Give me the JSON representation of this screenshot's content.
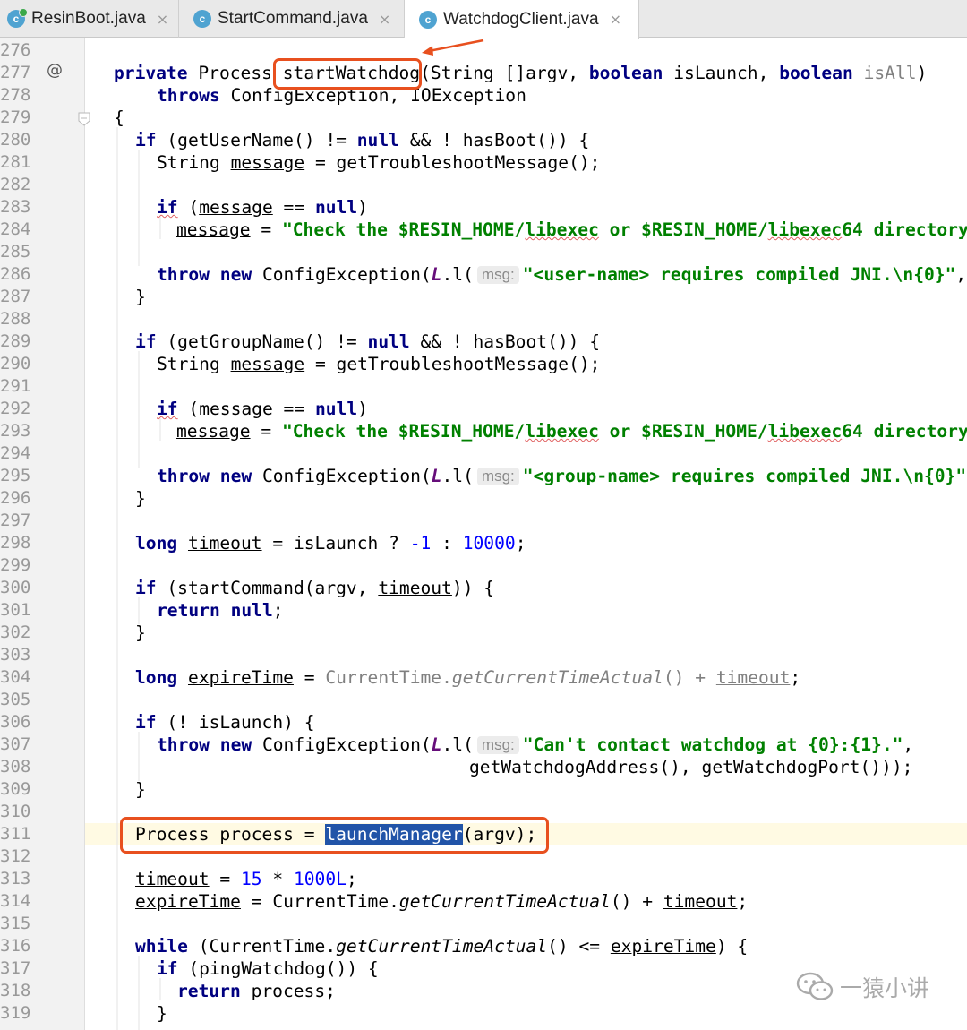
{
  "tabs": [
    {
      "label": "ResinBoot.java",
      "icon": "c",
      "running": true,
      "active": false
    },
    {
      "label": "StartCommand.java",
      "icon": "c",
      "running": false,
      "active": false
    },
    {
      "label": "WatchdogClient.java",
      "icon": "c",
      "running": false,
      "active": true
    }
  ],
  "close_glyph": "×",
  "gutter": {
    "annotation_marker": "@"
  },
  "hint_label": "msg:",
  "watermark": "一猿小讲",
  "annotation_color": "#e8501f",
  "lines": [
    {
      "n": "276",
      "t": []
    },
    {
      "n": "277",
      "t": [
        [
          "private",
          "k"
        ],
        [
          " Process "
        ],
        [
          "startWatchdog"
        ],
        [
          "(String []argv, "
        ],
        [
          "boolean",
          "k"
        ],
        [
          " isLaunch, "
        ],
        [
          "boolean",
          "k"
        ],
        [
          " "
        ],
        [
          "isAll",
          "g"
        ],
        [
          ")"
        ]
      ]
    },
    {
      "n": "278",
      "t": [
        [
          "throws",
          "k"
        ],
        [
          " ConfigException, IOException"
        ]
      ]
    },
    {
      "n": "279",
      "t": [
        [
          "{"
        ]
      ]
    },
    {
      "n": "280",
      "t": [
        [
          "if",
          "k"
        ],
        [
          " (getUserName() != "
        ],
        [
          "null",
          "k"
        ],
        [
          " && ! hasBoot()) {"
        ]
      ]
    },
    {
      "n": "281",
      "t": [
        [
          "String "
        ],
        [
          "message",
          "u"
        ],
        [
          " = getTroubleshootMessage();"
        ]
      ]
    },
    {
      "n": "282",
      "t": []
    },
    {
      "n": "283",
      "t": [
        [
          "if",
          "k w"
        ],
        [
          " ("
        ],
        [
          "message",
          "u"
        ],
        [
          " == "
        ],
        [
          "null",
          "k"
        ],
        [
          ")"
        ]
      ]
    },
    {
      "n": "284",
      "t": [
        [
          "message",
          "u"
        ],
        [
          " = "
        ],
        [
          "\"Check the $RESIN_HOME/",
          "s"
        ],
        [
          "libexec",
          "s w"
        ],
        [
          " or $RESIN_HOME/",
          "s"
        ],
        [
          "libexec",
          "s w"
        ],
        [
          "64 directory",
          "s"
        ]
      ]
    },
    {
      "n": "285",
      "t": []
    },
    {
      "n": "286",
      "t": [
        [
          "throw",
          "k"
        ],
        [
          " "
        ],
        [
          "new",
          "k"
        ],
        [
          " ConfigException("
        ],
        [
          "L",
          "f"
        ],
        [
          ".l("
        ],
        [
          "msg:",
          "hint"
        ],
        [
          "\"<user-name> requires compiled JNI.\\n{0}\"",
          "s"
        ],
        [
          ","
        ]
      ]
    },
    {
      "n": "287",
      "t": [
        [
          "}"
        ]
      ]
    },
    {
      "n": "288",
      "t": []
    },
    {
      "n": "289",
      "t": [
        [
          "if",
          "k"
        ],
        [
          " (getGroupName() != "
        ],
        [
          "null",
          "k"
        ],
        [
          " && ! hasBoot()) {"
        ]
      ]
    },
    {
      "n": "290",
      "t": [
        [
          "String "
        ],
        [
          "message",
          "u"
        ],
        [
          " = getTroubleshootMessage();"
        ]
      ]
    },
    {
      "n": "291",
      "t": []
    },
    {
      "n": "292",
      "t": [
        [
          "if",
          "k w"
        ],
        [
          " ("
        ],
        [
          "message",
          "u"
        ],
        [
          " == "
        ],
        [
          "null",
          "k"
        ],
        [
          ")"
        ]
      ]
    },
    {
      "n": "293",
      "t": [
        [
          "message",
          "u"
        ],
        [
          " = "
        ],
        [
          "\"Check the $RESIN_HOME/",
          "s"
        ],
        [
          "libexec",
          "s w"
        ],
        [
          " or $RESIN_HOME/",
          "s"
        ],
        [
          "libexec",
          "s w"
        ],
        [
          "64 directory",
          "s"
        ]
      ]
    },
    {
      "n": "294",
      "t": []
    },
    {
      "n": "295",
      "t": [
        [
          "throw",
          "k"
        ],
        [
          " "
        ],
        [
          "new",
          "k"
        ],
        [
          " ConfigException("
        ],
        [
          "L",
          "f"
        ],
        [
          ".l("
        ],
        [
          "msg:",
          "hint"
        ],
        [
          "\"<group-name> requires compiled JNI.\\n{0}\"",
          "s"
        ]
      ]
    },
    {
      "n": "296",
      "t": [
        [
          "}"
        ]
      ]
    },
    {
      "n": "297",
      "t": []
    },
    {
      "n": "298",
      "t": [
        [
          "long",
          "k"
        ],
        [
          " "
        ],
        [
          "timeout",
          "u"
        ],
        [
          " = isLaunch ? "
        ],
        [
          "-1",
          "n"
        ],
        [
          " : "
        ],
        [
          "10000",
          "n"
        ],
        [
          ";"
        ]
      ]
    },
    {
      "n": "299",
      "t": []
    },
    {
      "n": "300",
      "t": [
        [
          "if",
          "k"
        ],
        [
          " (startCommand(argv, "
        ],
        [
          "timeout",
          "u"
        ],
        [
          ")) {"
        ]
      ]
    },
    {
      "n": "301",
      "t": [
        [
          "return",
          "k"
        ],
        [
          " "
        ],
        [
          "null",
          "k"
        ],
        [
          ";"
        ]
      ]
    },
    {
      "n": "302",
      "t": [
        [
          "}"
        ]
      ]
    },
    {
      "n": "303",
      "t": []
    },
    {
      "n": "304",
      "t": [
        [
          "long",
          "k"
        ],
        [
          " "
        ],
        [
          "expireTime",
          "u"
        ],
        [
          " = "
        ],
        [
          "CurrentTime.",
          "g"
        ],
        [
          "getCurrentTimeActual",
          "gi"
        ],
        [
          "() + ",
          "g"
        ],
        [
          "timeout",
          "g u"
        ],
        [
          ";"
        ]
      ]
    },
    {
      "n": "305",
      "t": []
    },
    {
      "n": "306",
      "t": [
        [
          "if",
          "k"
        ],
        [
          " (! isLaunch) {"
        ]
      ]
    },
    {
      "n": "307",
      "t": [
        [
          "throw",
          "k"
        ],
        [
          " "
        ],
        [
          "new",
          "k"
        ],
        [
          " ConfigException("
        ],
        [
          "L",
          "f"
        ],
        [
          ".l("
        ],
        [
          "msg:",
          "hint"
        ],
        [
          "\"Can't contact watchdog at {0}:{1}.\"",
          "s"
        ],
        [
          ","
        ]
      ]
    },
    {
      "n": "308",
      "t": [
        [
          "getWatchdogAddress(), getWatchdogPort()));"
        ]
      ]
    },
    {
      "n": "309",
      "t": [
        [
          "}"
        ]
      ]
    },
    {
      "n": "310",
      "t": []
    },
    {
      "n": "311",
      "t": [
        [
          "Process process = "
        ],
        [
          "launchManager",
          "sel"
        ],
        [
          "(argv);"
        ]
      ]
    },
    {
      "n": "312",
      "t": []
    },
    {
      "n": "313",
      "t": [
        [
          "timeout",
          "u"
        ],
        [
          " = "
        ],
        [
          "15",
          "n"
        ],
        [
          " * "
        ],
        [
          "1000L",
          "n"
        ],
        [
          ";"
        ]
      ]
    },
    {
      "n": "314",
      "t": [
        [
          "expireTime",
          "u"
        ],
        [
          " = CurrentTime."
        ],
        [
          "getCurrentTimeActual",
          "it"
        ],
        [
          "() + "
        ],
        [
          "timeout",
          "u"
        ],
        [
          ";"
        ]
      ]
    },
    {
      "n": "315",
      "t": []
    },
    {
      "n": "316",
      "t": [
        [
          "while",
          "k"
        ],
        [
          " (CurrentTime."
        ],
        [
          "getCurrentTimeActual",
          "it"
        ],
        [
          "() <= "
        ],
        [
          "expireTime",
          "u"
        ],
        [
          ") {"
        ]
      ]
    },
    {
      "n": "317",
      "t": [
        [
          "if",
          "k"
        ],
        [
          " (pingWatchdog()) {"
        ]
      ]
    },
    {
      "n": "318",
      "t": [
        [
          "return",
          "k"
        ],
        [
          " process;"
        ]
      ]
    },
    {
      "n": "319",
      "t": [
        [
          "}"
        ]
      ]
    }
  ]
}
